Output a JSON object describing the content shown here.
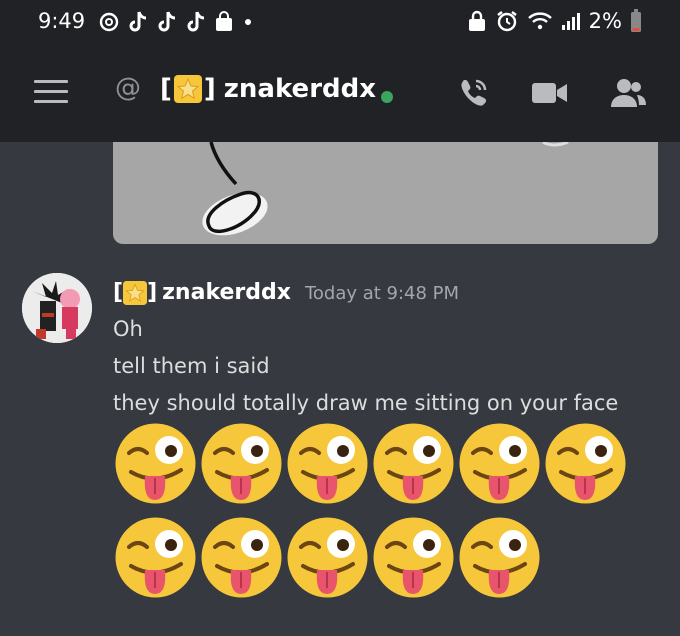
{
  "status_bar": {
    "time": "9:49",
    "battery": "2%"
  },
  "header": {
    "at_symbol": "@",
    "bracket_open": "[",
    "bracket_close": "]",
    "username": "znakerddx"
  },
  "message": {
    "author_bracket_open": "[",
    "author_bracket_close": "]",
    "author": "znakerddx",
    "timestamp": "Today at 9:48 PM",
    "lines": [
      "Oh",
      "tell them i said",
      "they should totally draw me sitting on your face"
    ],
    "emoji_rows": [
      6,
      5
    ]
  },
  "colors": {
    "background": "#36393f",
    "header": "#202225",
    "online": "#3ba55d",
    "emoji_face": "#f6c73a"
  },
  "icons": [
    "menu-icon",
    "at-icon",
    "star-emoji",
    "call-icon",
    "video-icon",
    "members-icon",
    "zany-face-emoji"
  ]
}
